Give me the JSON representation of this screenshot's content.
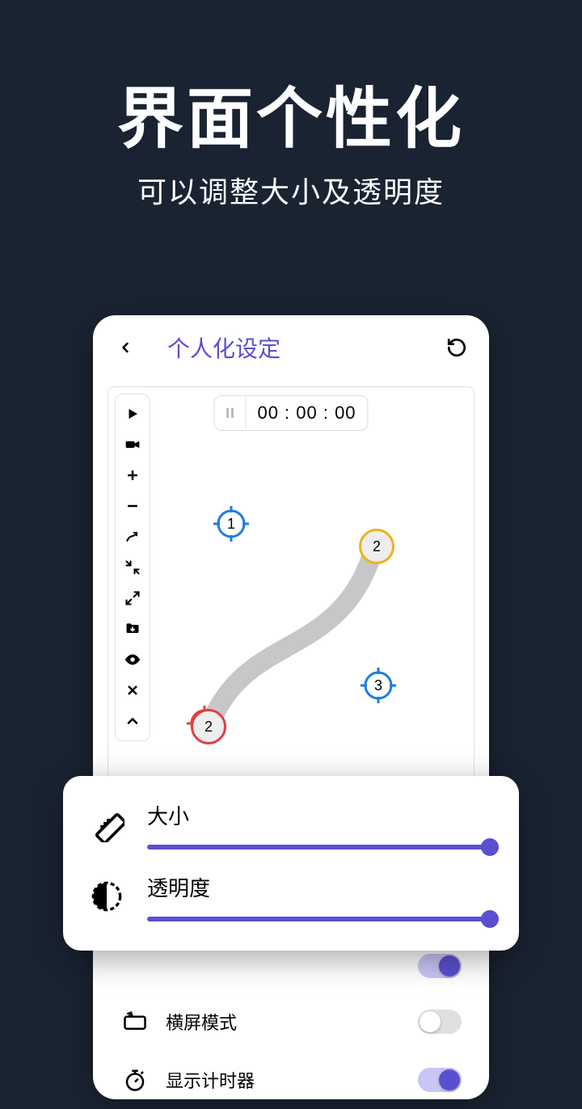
{
  "hero": {
    "title": "界面个性化",
    "subtitle": "可以调整大小及透明度"
  },
  "panel": {
    "title": "个人化设定",
    "timer": "00 : 00 : 00"
  },
  "targets": {
    "t1": "1",
    "t2": "2",
    "t3": "3",
    "end_label": "2"
  },
  "sliders": {
    "size_label": "大小",
    "opacity_label": "透明度"
  },
  "settings": {
    "hidden_toggle_on": true,
    "landscape_label": "横屏模式",
    "landscape_on": false,
    "timer_label": "显示计时器",
    "timer_on": true
  },
  "icons": {
    "back": "chevron-left-icon",
    "reset": "undo-icon",
    "play": "play-icon",
    "record": "video-icon",
    "plus": "plus-icon",
    "minus": "minus-icon",
    "curve": "curve-arrow-icon",
    "contract": "contract-icon",
    "expand": "expand-icon",
    "import": "folder-down-icon",
    "eye": "eye-icon",
    "close": "close-icon",
    "collapse": "chevron-up-icon",
    "pause": "pause-icon",
    "ruler": "ruler-icon",
    "contrast": "contrast-icon",
    "landscape": "landscape-icon",
    "stopwatch": "stopwatch-icon"
  }
}
